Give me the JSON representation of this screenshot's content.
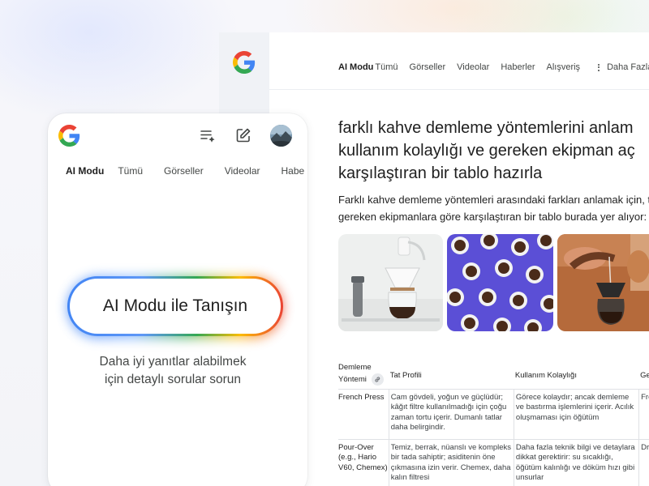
{
  "desktop": {
    "tabs": [
      {
        "label": "AI Modu",
        "active": true
      },
      {
        "label": "Tümü"
      },
      {
        "label": "Görseller"
      },
      {
        "label": "Videolar"
      },
      {
        "label": "Haberler"
      },
      {
        "label": "Alışveriş"
      }
    ],
    "more_label": "Daha Fazla",
    "query_lines": [
      "farklı kahve demleme yöntemlerini anlam",
      "kullanım kolaylığı ve gereken ekipman aç",
      "karşılaştıran bir tablo hazırla"
    ],
    "answer_lines": [
      "Farklı kahve demleme yöntemleri arasındaki farkları anlamak için, ta",
      "gereken ekipmanlara göre karşılaştıran bir tablo burada yer alıyor:"
    ],
    "table": {
      "headers": [
        "Demleme Yöntemi",
        "Tat Profili",
        "Kullanım Kolaylığı",
        "Ge"
      ],
      "rows": [
        {
          "method": "French Press",
          "taste": "Cam gövdeli, yoğun ve güçlüdür; kâğıt filtre kullanılmadığı için çoğu zaman tortu içerir. Dumanlı tatlar daha belirgindir.",
          "ease": "Görece kolaydır; ancak demleme ve bastırma işlemlerini içerir. Acılık oluşmaması için öğütüm",
          "equip": "Fre"
        },
        {
          "method": "Pour-Over (e.g., Hario V60, Chemex)",
          "taste": "Temiz, berrak, nüanslı ve kompleks bir tada sahiptir; asiditenin öne çıkmasına izin verir. Chemex, daha kalın filtresi",
          "ease": "Daha fazla teknik bilgi ve detaylara dikkat gerektirir: su sıcaklığı, öğütüm kalınlığı ve döküm hızı gibi unsurlar",
          "equip": "Dri"
        }
      ]
    }
  },
  "mobile": {
    "tabs": [
      {
        "label": "AI Modu",
        "active": true
      },
      {
        "label": "Tümü"
      },
      {
        "label": "Görseller"
      },
      {
        "label": "Videolar"
      },
      {
        "label": "Habe"
      }
    ],
    "cta_label": "AI Modu ile Tanışın",
    "subtitle_lines": [
      "Daha iyi yanıtlar alabilmek",
      "için detaylı sorular sorun"
    ]
  },
  "icons": {
    "logo": "google-g-icon",
    "history": "history-list-icon",
    "new_chat": "edit-icon",
    "more": "more-vert-icon",
    "link": "link-icon"
  },
  "colors": {
    "google_blue": "#4285f4",
    "google_red": "#ea4335",
    "google_yellow": "#fbbc04",
    "google_green": "#34a853",
    "image_purple": "#5b4fd6"
  }
}
